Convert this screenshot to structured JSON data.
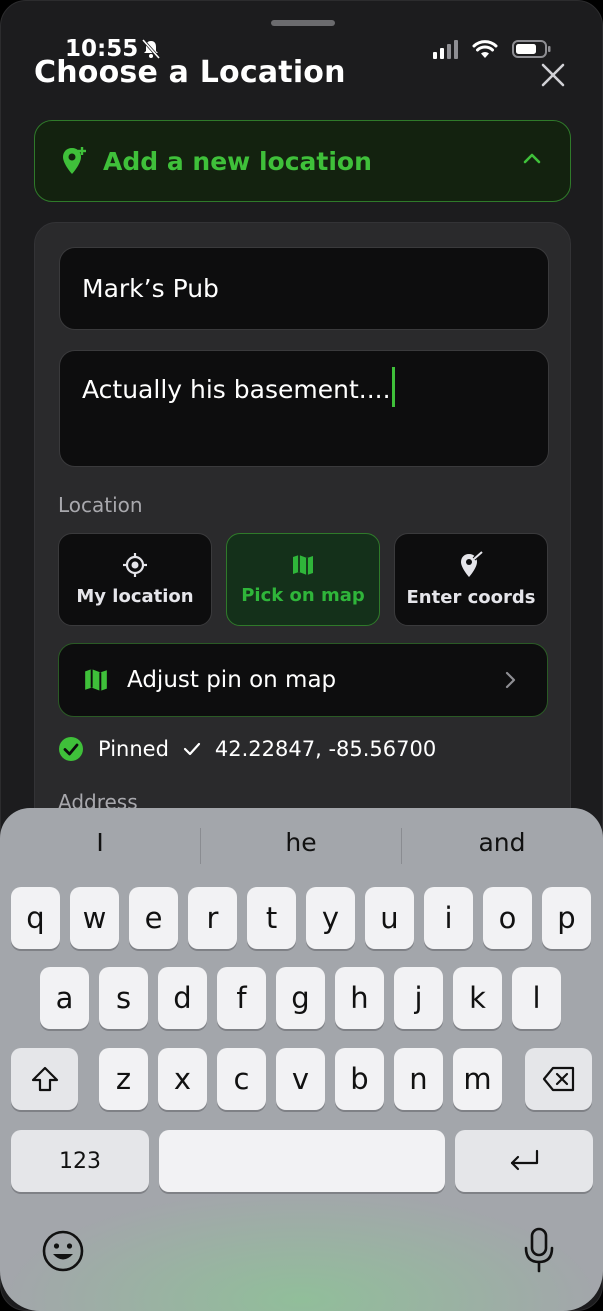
{
  "status": {
    "time": "10:55"
  },
  "sheet": {
    "title": "Choose a Location"
  },
  "add_new": {
    "label": "Add a new location"
  },
  "form": {
    "name_value": "Mark’s Pub",
    "description_value": "Actually his basement....",
    "location_label": "Location",
    "options": [
      "My location",
      "Pick on map",
      "Enter coords"
    ],
    "adjust_label": "Adjust pin on map",
    "pinned_label": "Pinned",
    "coords": "42.22847, -85.56700",
    "address_label": "Address"
  },
  "keyboard": {
    "suggestions": [
      "I",
      "he",
      "and"
    ],
    "row1": [
      "q",
      "w",
      "e",
      "r",
      "t",
      "y",
      "u",
      "i",
      "o",
      "p"
    ],
    "row2": [
      "a",
      "s",
      "d",
      "f",
      "g",
      "h",
      "j",
      "k",
      "l"
    ],
    "row3": [
      "z",
      "x",
      "c",
      "v",
      "b",
      "n",
      "m"
    ],
    "numbers_label": "123"
  },
  "colors": {
    "accent": "#3fc03a",
    "sheet_bg": "#1c1c1e",
    "card_bg": "#2a2a2c"
  }
}
